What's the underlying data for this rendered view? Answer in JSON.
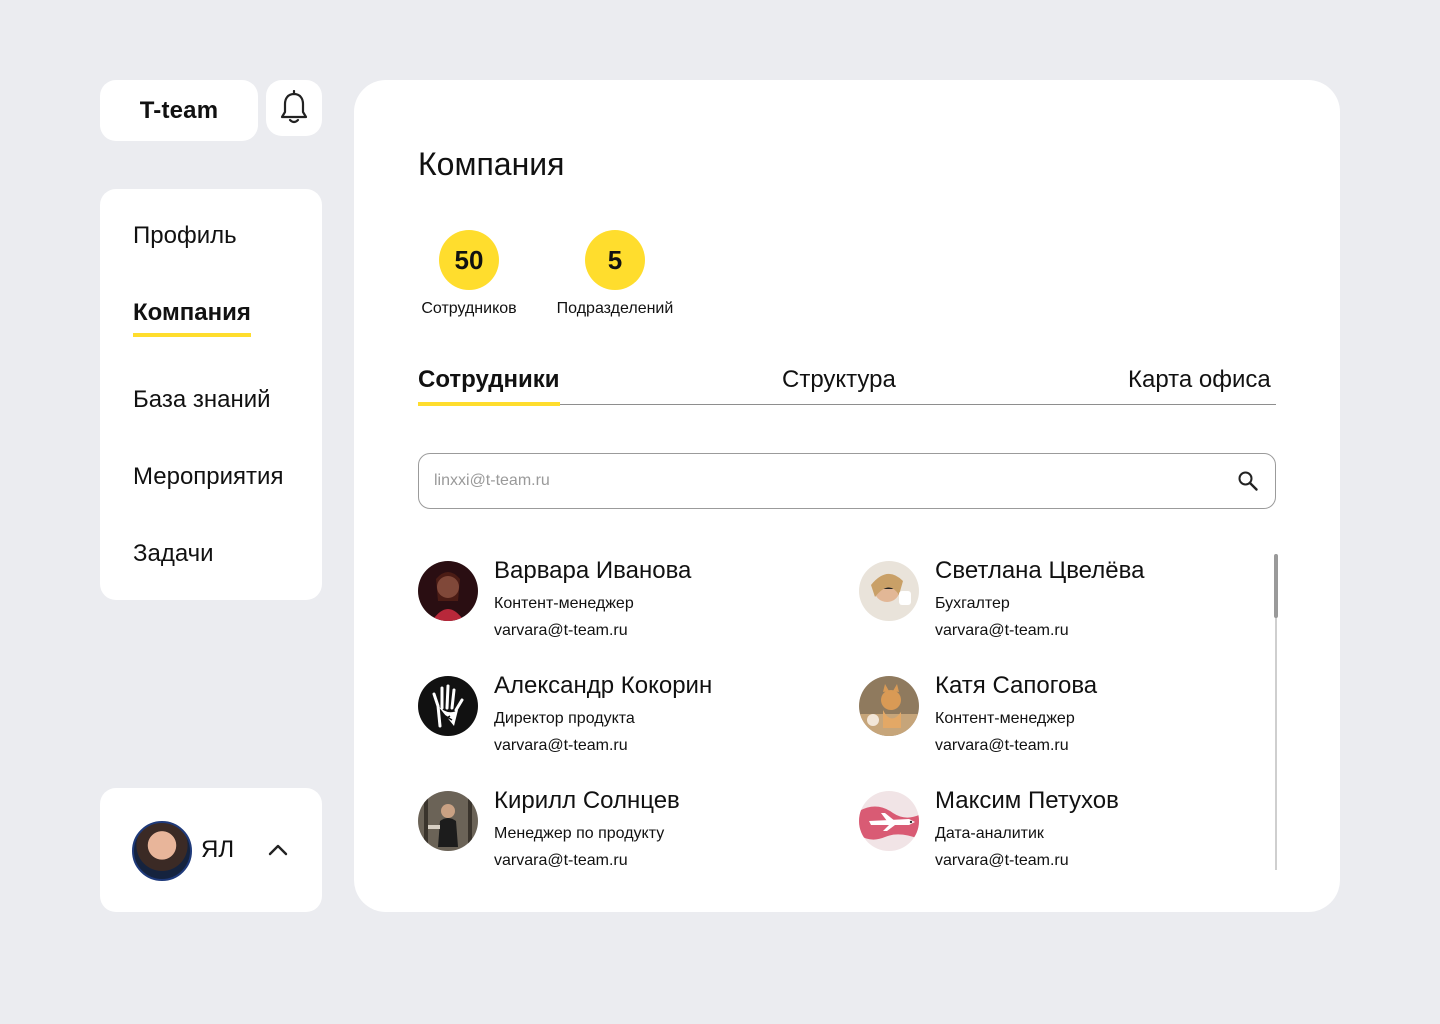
{
  "brand": {
    "logo": "T-team"
  },
  "nav": {
    "items": [
      {
        "label": "Профиль",
        "active": false
      },
      {
        "label": "Компания",
        "active": true
      },
      {
        "label": "База знаний",
        "active": false
      },
      {
        "label": "Мероприятия",
        "active": false
      },
      {
        "label": "Задачи",
        "active": false
      }
    ]
  },
  "user": {
    "initials": "ЯЛ"
  },
  "main": {
    "title": "Компания",
    "stats": [
      {
        "value": "50",
        "label": "Сотрудников"
      },
      {
        "value": "5",
        "label": "Подразделений"
      }
    ],
    "tabs": [
      {
        "label": "Сотрудники",
        "active": true
      },
      {
        "label": "Структура",
        "active": false
      },
      {
        "label": "Карта офиса",
        "active": false
      }
    ],
    "search": {
      "placeholder": "linxxi@t-team.ru"
    },
    "employees": [
      {
        "name": "Варвара Иванова",
        "role": "Контент-менеджер",
        "email": "varvara@t-team.ru"
      },
      {
        "name": "Светлана Цвелёва",
        "role": "Бухгалтер",
        "email": "varvara@t-team.ru"
      },
      {
        "name": "Александр Кокорин",
        "role": "Директор продукта",
        "email": "varvara@t-team.ru"
      },
      {
        "name": "Катя Сапогова",
        "role": "Контент-менеджер",
        "email": "varvara@t-team.ru"
      },
      {
        "name": "Кирилл Солнцев",
        "role": "Менеджер по продукту",
        "email": "varvara@t-team.ru"
      },
      {
        "name": "Максим Петухов",
        "role": "Дата-аналитик",
        "email": "varvara@t-team.ru"
      }
    ]
  },
  "colors": {
    "accent": "#ffdd2d",
    "background": "#ebecf0",
    "card": "#ffffff"
  },
  "icons": {
    "bell": "bell-icon",
    "search": "search-icon",
    "chevron": "chevron-up-icon"
  }
}
